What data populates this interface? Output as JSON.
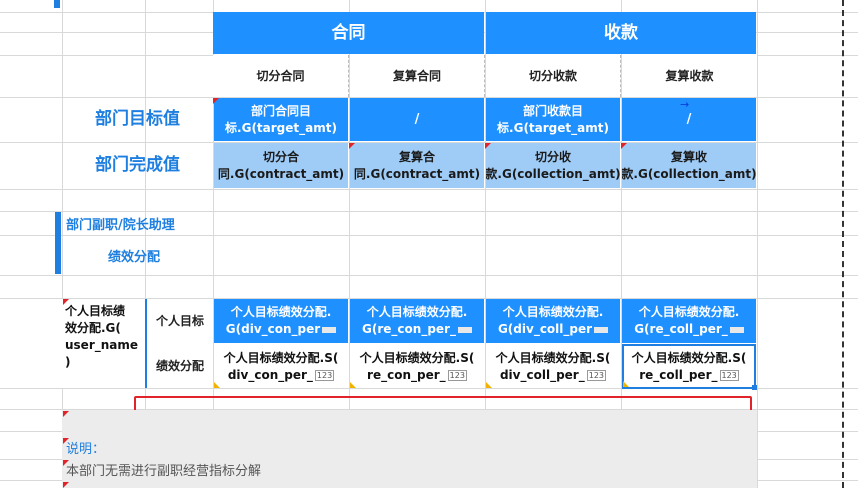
{
  "header": {
    "hetong": "合同",
    "shoukuan": "收款",
    "sub1": "切分合同",
    "sub2": "复算合同",
    "sub3": "切分收款",
    "sub4": "复算收款"
  },
  "rows": {
    "target_label": "部门目标值",
    "done_label": "部门完成值",
    "target": [
      "部门合同目标.G(target_amt)",
      "/",
      "部门收款目标.G(target_amt)",
      "/"
    ],
    "done": [
      "切分合同.G(contract_amt)",
      "复算合同.G(contract_amt)",
      "切分收款.G(collection_amt)",
      "复算收款.G(collection_amt)"
    ]
  },
  "section": {
    "title": "部门副职/院长助理",
    "subtitle": "绩效分配"
  },
  "personal": {
    "left_label": "个人目标绩效分配.G(user_name)",
    "left_line1": "个人目标绩",
    "left_line2": "效分配.G(",
    "left_line3": "user_name",
    "left_line4": ")",
    "target_label": "个人目标",
    "perf_label": "绩效分配",
    "row1": [
      {
        "l1": "个人目标绩效分配.",
        "l2": "G(div_con_per"
      },
      {
        "l1": "个人目标绩效分配.",
        "l2": "G(re_con_per_"
      },
      {
        "l1": "个人目标绩效分配.",
        "l2": "G(div_coll_per"
      },
      {
        "l1": "个人目标绩效分配.",
        "l2": "G(re_coll_per_"
      }
    ],
    "row2": [
      {
        "l1": "个人目标绩效分配.S(",
        "l2": "div_con_per_"
      },
      {
        "l1": "个人目标绩效分配.S(",
        "l2": "re_con_per_"
      },
      {
        "l1": "个人目标绩效分配.S(",
        "l2": "div_coll_per_"
      },
      {
        "l1": "个人目标绩效分配.S(",
        "l2": "re_coll_per_"
      }
    ],
    "badge": "123"
  },
  "notes": {
    "title": "说明：",
    "text": "本部门无需进行副职经营指标分解"
  },
  "colors": {
    "accent": "#1e90ff",
    "light": "#9fccf7",
    "highlight": "#e0242a"
  }
}
